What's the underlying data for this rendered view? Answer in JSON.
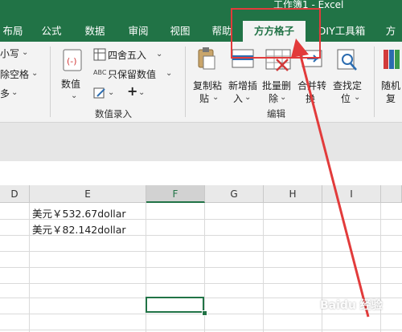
{
  "window": {
    "title": "工作簿1 - Excel"
  },
  "tabs": [
    {
      "label": "布局"
    },
    {
      "label": "公式"
    },
    {
      "label": "数据"
    },
    {
      "label": "审阅"
    },
    {
      "label": "视图"
    },
    {
      "label": "帮助"
    },
    {
      "label": "方方格子"
    },
    {
      "label": "DIY工具箱"
    },
    {
      "label": "方"
    }
  ],
  "ribbon": {
    "left_group": {
      "item1": "小写",
      "item2": "除空格",
      "item3": "多"
    },
    "numeric_group": {
      "values_button": "数值",
      "round_button": "四舍五入",
      "keep_value_button": "只保留数值",
      "label": "数值录入"
    },
    "edit_group": {
      "copy_paste": [
        "复制粘",
        "贴"
      ],
      "insert": [
        "新增插",
        "入"
      ],
      "batch_delete": [
        "批量删",
        "除"
      ],
      "merge_convert": [
        "合并转",
        "换"
      ],
      "find_locate": [
        "查找定",
        "位"
      ],
      "label": "编辑"
    },
    "right_group": {
      "random": [
        "随机",
        "复"
      ]
    }
  },
  "sheet": {
    "columns": [
      "D",
      "E",
      "F",
      "G",
      "H",
      "I"
    ],
    "selected_column": "F",
    "cells": [
      {
        "text": "美元￥532.67dollar"
      },
      {
        "text": "美元￥82.142dollar"
      }
    ]
  },
  "annotation": {
    "color": "#e23b3b"
  },
  "watermark": {
    "text": "Baidu 经验"
  }
}
